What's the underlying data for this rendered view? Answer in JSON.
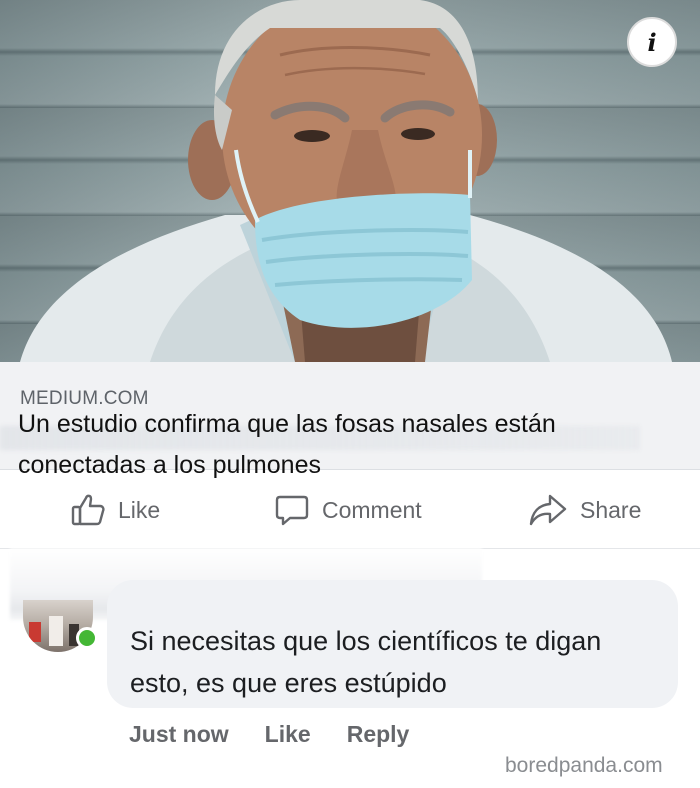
{
  "post": {
    "link_preview": {
      "info_icon": "info-icon",
      "domain": "MEDIUM.COM",
      "title": "Un estudio confirma que las fosas nasales están conectadas a los pulmones"
    },
    "actions": {
      "like": {
        "label": "Like",
        "icon": "thumbs-up-icon"
      },
      "comment": {
        "label": "Comment",
        "icon": "speech-bubble-icon"
      },
      "share": {
        "label": "Share",
        "icon": "share-arrow-icon"
      }
    }
  },
  "comment": {
    "text": "Si necesitas que los científicos te digan esto, es que eres estúpido",
    "status_color": "#44b735",
    "meta": {
      "time": "Just now",
      "like": "Like",
      "reply": "Reply"
    }
  },
  "watermark": "boredpanda.com",
  "colors": {
    "text_primary": "#1c1e21",
    "text_secondary": "#65676b",
    "bubble_bg": "#f0f2f5",
    "caption_bg": "#f1f2f4"
  }
}
